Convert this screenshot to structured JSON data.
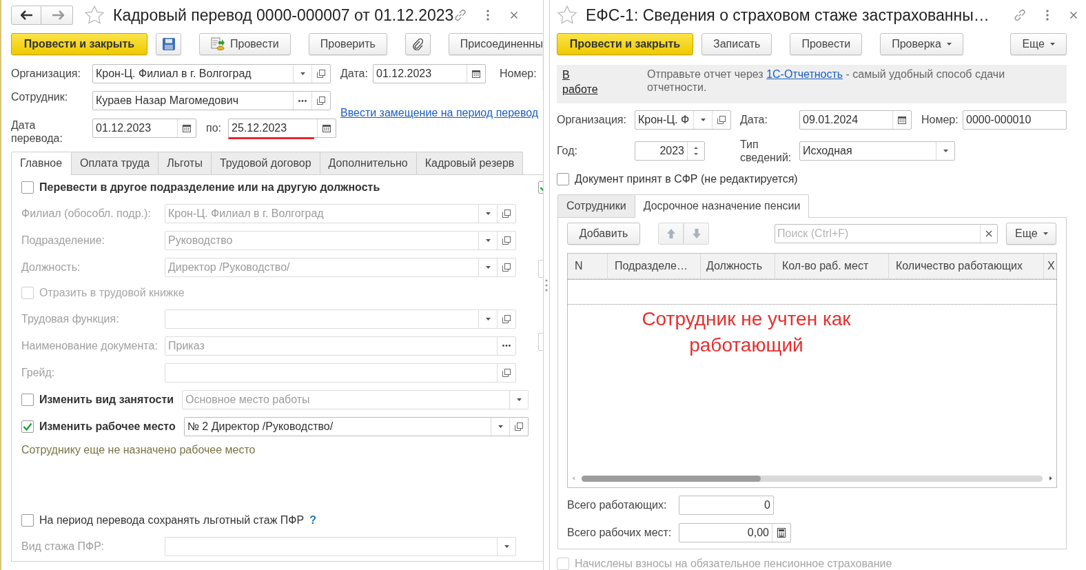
{
  "left": {
    "title": "Кадровый перевод 0000-000007 от 01.12.2023",
    "toolbar": [
      {
        "kind": "primary",
        "label": "Провести и закрыть"
      },
      {
        "kind": "save"
      },
      {
        "kind": "post",
        "label": "Провести"
      },
      {
        "kind": "plain",
        "label": "Проверить"
      },
      {
        "kind": "attach"
      },
      {
        "kind": "plain",
        "label": "Присоединенны"
      }
    ],
    "organization": {
      "label": "Организация:",
      "value": "Крон-Ц. Филиал в г. Волгоград",
      "kind": "select"
    },
    "date": {
      "label": "Дата:",
      "value": "01.12.2023",
      "kind": "date"
    },
    "number": {
      "label": "Номер:"
    },
    "employee": {
      "label": "Сотрудник:",
      "value": "Кураев Назар Магомедович",
      "kind": "choice"
    },
    "substitution_link": "Ввести замещение на период перевод",
    "transfer": {
      "label": "Дата перевода:",
      "from": {
        "value": "01.12.2023",
        "kind": "date"
      },
      "to_label": "по:",
      "to": {
        "value": "25.12.2023",
        "kind": "date",
        "highlighted": true
      }
    },
    "tabs": [
      {
        "label": "Главное",
        "selected": true
      },
      {
        "label": "Оплата труда",
        "selected": false
      },
      {
        "label": "Льготы",
        "selected": false
      },
      {
        "label": "Трудовой договор",
        "selected": false
      },
      {
        "label": "Дополнительно",
        "selected": false
      },
      {
        "label": "Кадровый резерв",
        "selected": false
      }
    ],
    "rows": [
      {
        "kind": "section_check",
        "label": "Перевести в другое подразделение или на другую должность",
        "checked": false
      },
      {
        "kind": "field",
        "label": "Филиал (обособл. подр.):",
        "input": {
          "kind": "select",
          "value": "Крон-Ц. Филиал в г. Волгоград",
          "disabled": true
        }
      },
      {
        "kind": "field",
        "label": "Подразделение:",
        "input": {
          "kind": "select",
          "value": "Руководство",
          "disabled": true
        }
      },
      {
        "kind": "field",
        "label": "Должность:",
        "input": {
          "kind": "select",
          "value": "Директор /Руководство/",
          "disabled": true
        }
      },
      {
        "kind": "check",
        "label": "Отразить в трудовой книжке",
        "checked": false,
        "disabled": true
      },
      {
        "kind": "field",
        "label": "Трудовая функция:",
        "input": {
          "kind": "select",
          "disabled": true
        }
      },
      {
        "kind": "field",
        "label": "Наименование документа:",
        "input": {
          "kind": "pick",
          "value": "Приказ",
          "disabled": true
        }
      },
      {
        "kind": "field",
        "label": "Грейд:",
        "input": {
          "kind": "open",
          "disabled": true
        }
      },
      {
        "kind": "check_field",
        "label": "Изменить вид занятости",
        "checked": false,
        "input": {
          "kind": "dropdown",
          "value": "Основное место работы",
          "disabled": true
        }
      },
      {
        "kind": "check_field",
        "label": "Изменить рабочее место",
        "checked": true,
        "input": {
          "kind": "select",
          "value": "№ 2 Директор /Руководство/",
          "disabled": false
        }
      },
      {
        "kind": "note",
        "text": "Сотруднику еще не назначено рабочее место"
      }
    ],
    "pension_rows": [
      {
        "kind": "check",
        "label": "На период перевода сохранять льготный стаж ПФР",
        "help": "?",
        "checked": false,
        "disabled": false
      },
      {
        "kind": "field",
        "label": "Вид стажа ПФР:",
        "input": {
          "kind": "dropdown",
          "disabled": true
        }
      }
    ],
    "cut_column": [
      {
        "kind": "check",
        "checked": true
      },
      {
        "kind": "field"
      },
      {
        "kind": "field"
      }
    ]
  },
  "right": {
    "title": "ЕФС-1: Сведения о страховом стаже застрахованны…",
    "toolbar": [
      {
        "kind": "primary",
        "label": "Провести и закрыть"
      },
      {
        "kind": "plain",
        "label": "Записать"
      },
      {
        "kind": "plain",
        "label": "Провести"
      },
      {
        "kind": "menu",
        "label": "Проверка"
      }
    ],
    "more": {
      "kind": "menu",
      "label": "Еще"
    },
    "info": {
      "status_link": "В работе",
      "text_before": "Отправьте отчет через ",
      "link": "1С-Отчетность",
      "text_after": " - самый удобный способ сдачи отчетности."
    },
    "organization": {
      "label": "Организация:",
      "value": "Крон-Ц. Ф",
      "kind": "select"
    },
    "date": {
      "label": "Дата:",
      "value": "09.01.2024",
      "kind": "date"
    },
    "number": {
      "label": "Номер:",
      "value": "0000-000010"
    },
    "year": {
      "label": "Год:",
      "value": "2023",
      "kind": "spin"
    },
    "info_type": {
      "label": "Тип сведений:",
      "value": "Исходная",
      "kind": "dropdown"
    },
    "accepted": {
      "label": "Документ принят в СФР (не редактируется)",
      "checked": false
    },
    "tabs": [
      {
        "label": "Сотрудники",
        "selected": false
      },
      {
        "label": "Досрочное назначение пенсии",
        "selected": true
      }
    ],
    "table_toolbar": {
      "add": "Добавить",
      "search_placeholder": "Поиск (Ctrl+F)",
      "more": "Еще"
    },
    "table": {
      "columns": [
        "N",
        "Подразделе…",
        "Должность",
        "Кол-во раб. мест",
        "Количество работающих",
        "Х"
      ]
    },
    "annotation": "Сотрудник не учтен как работающий",
    "total_working": {
      "label": "Всего работающих:",
      "value": "0"
    },
    "total_places": {
      "label": "Всего рабочих мест:",
      "value": "0,00",
      "kind": "calc"
    },
    "contributions": {
      "label": "Начислены взносы на обязательное пенсионное страхование",
      "checked": false,
      "disabled": true
    }
  }
}
